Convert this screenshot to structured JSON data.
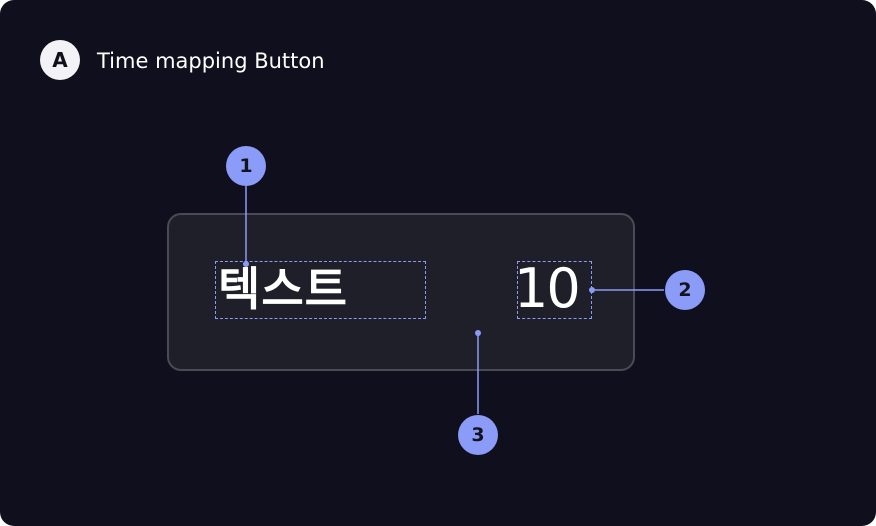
{
  "section": {
    "badge": "A",
    "title": "Time mapping Button"
  },
  "button": {
    "label": "텍스트",
    "value": "10"
  },
  "callouts": [
    "1",
    "2",
    "3"
  ],
  "colors": {
    "background": "#100f1d",
    "button_fill": "#1e1f28",
    "button_border": "#4a4a54",
    "accent": "#8a9cf7",
    "text": "#ffffff"
  }
}
